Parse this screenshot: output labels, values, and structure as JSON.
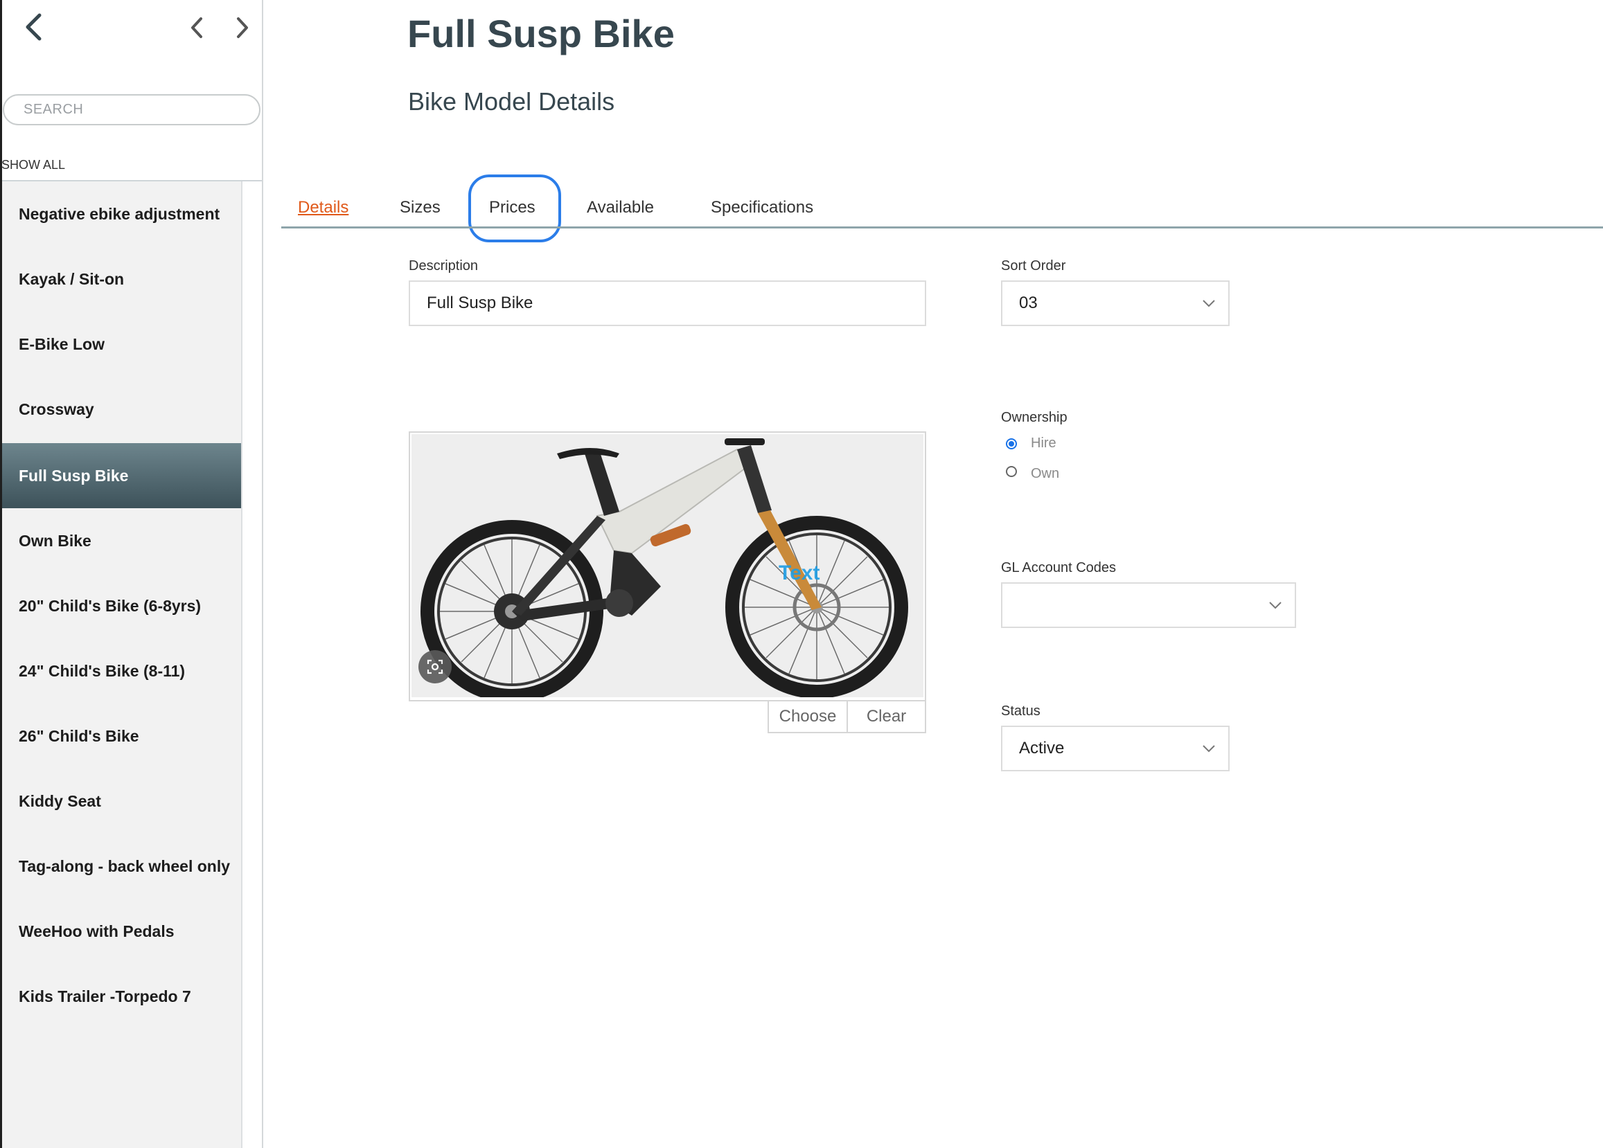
{
  "sidebar": {
    "search": {
      "placeholder": "SEARCH"
    },
    "show_all": "SHOW ALL",
    "items": [
      {
        "label": "Negative ebike adjustment",
        "selected": false
      },
      {
        "label": "Kayak / Sit-on",
        "selected": false
      },
      {
        "label": "E-Bike Low",
        "selected": false
      },
      {
        "label": "Crossway",
        "selected": false
      },
      {
        "label": "Full Susp Bike",
        "selected": true
      },
      {
        "label": "Own Bike",
        "selected": false
      },
      {
        "label": "20\" Child's Bike (6-8yrs)",
        "selected": false
      },
      {
        "label": "24\" Child's Bike (8-11)",
        "selected": false
      },
      {
        "label": "26\" Child's Bike",
        "selected": false
      },
      {
        "label": "Kiddy Seat",
        "selected": false
      },
      {
        "label": "Tag-along - back wheel only",
        "selected": false
      },
      {
        "label": "WeeHoo with Pedals",
        "selected": false
      },
      {
        "label": "Kids Trailer -Torpedo 7",
        "selected": false
      }
    ]
  },
  "header": {
    "title": "Full Susp Bike",
    "subtitle": "Bike Model Details"
  },
  "tabs": [
    {
      "label": "Details",
      "active": true
    },
    {
      "label": "Sizes",
      "active": false
    },
    {
      "label": "Prices",
      "active": false,
      "highlighted": true
    },
    {
      "label": "Available",
      "active": false
    },
    {
      "label": "Specifications",
      "active": false
    }
  ],
  "form": {
    "description": {
      "label": "Description",
      "value": "Full Susp Bike"
    },
    "sort_order": {
      "label": "Sort Order",
      "value": "03"
    },
    "ownership": {
      "label": "Ownership",
      "options": [
        {
          "label": "Hire",
          "checked": true
        },
        {
          "label": "Own",
          "checked": false
        }
      ]
    },
    "gl_account_codes": {
      "label": "GL Account Codes",
      "value": ""
    },
    "status": {
      "label": "Status",
      "value": "Active"
    }
  },
  "image": {
    "overlay_text": "Text",
    "choose_label": "Choose",
    "clear_label": "Clear"
  },
  "colors": {
    "accent": "#2b7de9",
    "active_tab": "#e05a1b",
    "selected_item_top": "#6d858d",
    "selected_item_bottom": "#3d525a",
    "title": "#37474f"
  }
}
